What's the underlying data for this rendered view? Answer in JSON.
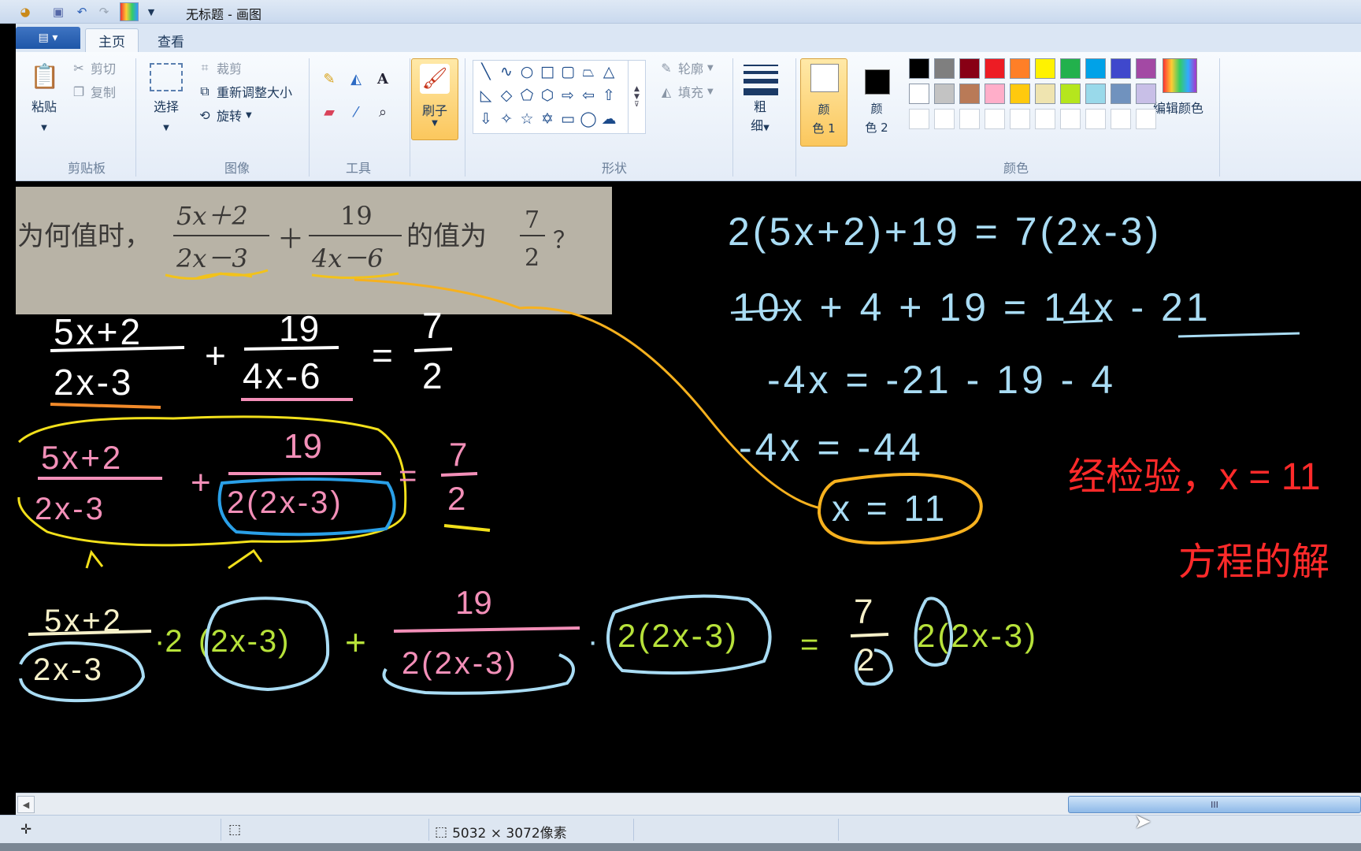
{
  "window": {
    "title": "无标题 - 画图"
  },
  "tabs": {
    "home": "主页",
    "view": "查看"
  },
  "ribbon": {
    "clipboard": {
      "paste": "粘贴",
      "cut": "剪切",
      "copy": "复制",
      "label": "剪贴板"
    },
    "image": {
      "select": "选择",
      "crop": "裁剪",
      "resize": "重新调整大小",
      "rotate": "旋转",
      "label": "图像"
    },
    "tools": {
      "label": "工具",
      "text_tool": "A"
    },
    "brush": {
      "label": "刷子"
    },
    "shapes": {
      "outline": "轮廓",
      "fill": "填充",
      "label": "形状"
    },
    "size": {
      "label_1": "粗",
      "label_2": "细"
    },
    "colors": {
      "color1_a": "颜",
      "color1_b": "色 1",
      "color2_a": "颜",
      "color2_b": "色 2",
      "edit": "编辑颜色",
      "label": "颜色",
      "row1": [
        "#000000",
        "#7f7f7f",
        "#880015",
        "#ed1c24",
        "#ff7f27",
        "#fff200",
        "#22b14c",
        "#00a2e8",
        "#3f48cc",
        "#a349a4"
      ],
      "row2": [
        "#ffffff",
        "#c3c3c3",
        "#b97a57",
        "#ffaec9",
        "#ffc90e",
        "#efe4b0",
        "#b5e61d",
        "#99d9ea",
        "#7092be",
        "#c8bfe7"
      ]
    }
  },
  "problem": {
    "prefix": "为何值时，",
    "f1_num": "5x＋2",
    "f1_den": "2x－3",
    "plus": "＋",
    "f2_num": "19",
    "f2_den": "4x－6",
    "middle": "的值为",
    "f3_num": "7",
    "f3_den": "2",
    "suffix": "？"
  },
  "handwriting": {
    "r1": "2(5x+2)+19 = 7(2x-3)",
    "r2": "10x + 4 + 19 = 14x - 21",
    "r3": "-4x = -21 - 19 - 4",
    "r4": "-4x = -44",
    "r5": "x = 11",
    "red1": "经检验，x = 11",
    "red2": "方程的解",
    "l_num1": "5x+2",
    "l_den1": "2x-3",
    "l_num2": "19",
    "l_den2": "4x-6",
    "l_rhs_num": "7",
    "l_rhs_den": "2",
    "plus": "+",
    "eq": "=",
    "m_num1": "5x+2",
    "m_den1": "2x-3",
    "m_num2": "19",
    "m_den2": "2(2x-3)",
    "m_rhs_num": "7",
    "m_rhs_den": "2",
    "b_num1": "5x+2",
    "b_den1": "2x-3",
    "b_mult1": "·2",
    "b_mult1b": "(2x-3)",
    "b_num2": "19",
    "b_den2": "2(2x-3)",
    "b_mult2": "2(2x-3)",
    "b_rhs_num": "7",
    "b_rhs_den": "2",
    "b_mult3": "2(2x-3)",
    "dot": "·"
  },
  "status": {
    "canvas_size": "5032 × 3072像素"
  },
  "scroll": {
    "thumb_grip": "III"
  }
}
